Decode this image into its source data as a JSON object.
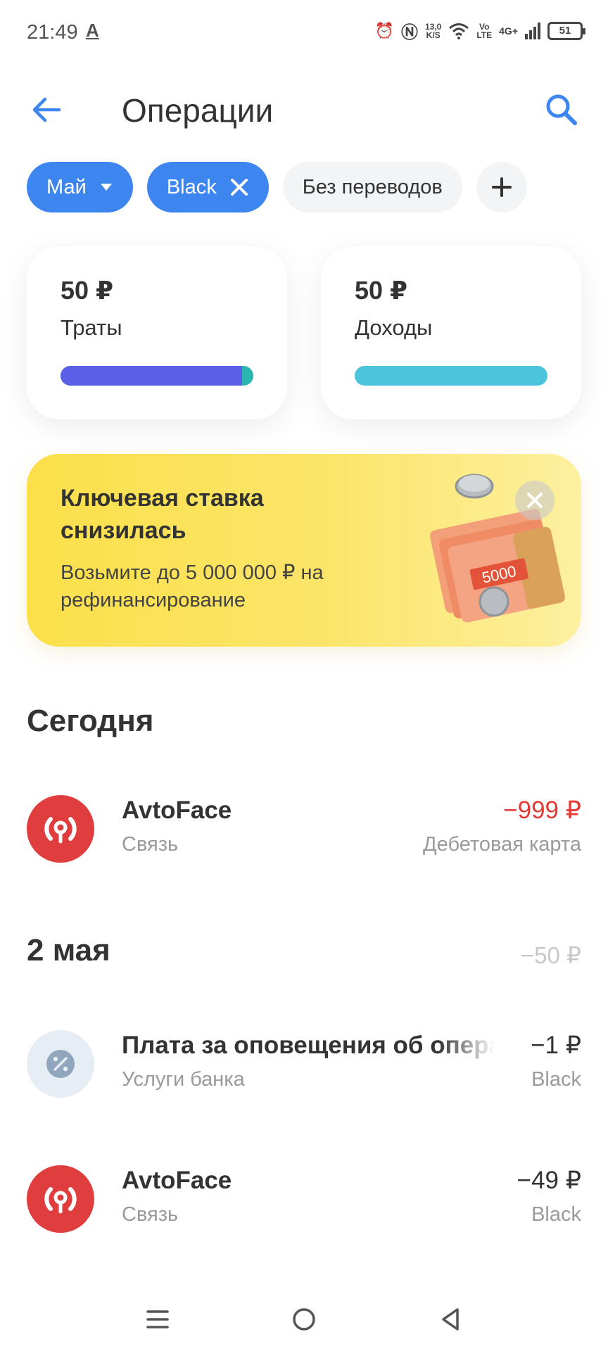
{
  "status_bar": {
    "time": "21:49",
    "a_icon": "A",
    "speed_value": "13,0",
    "speed_unit": "K/S",
    "volte_top": "Vo",
    "volte_bottom": "LTE",
    "network": "4G+",
    "battery": "51"
  },
  "header": {
    "title": "Операции"
  },
  "filters": {
    "month": "Май",
    "card": "Black",
    "no_transfers": "Без переводов"
  },
  "summary": {
    "expenses": {
      "amount": "50 ₽",
      "label": "Траты",
      "fill": 0.94,
      "color": "#5b5fe8",
      "accent": "#2bb5b0"
    },
    "income": {
      "amount": "50 ₽",
      "label": "Доходы",
      "fill": 1.0,
      "color": "#4cc4dc"
    }
  },
  "promo": {
    "title": "Ключевая ставка снизилась",
    "text": "Возьмите до 5 000 000 ₽ на рефинансирование",
    "banknote": "5000"
  },
  "sections": [
    {
      "title": "Сегодня",
      "total": "",
      "operations": [
        {
          "name": "AvtoFace",
          "category": "Связь",
          "amount": "−999 ₽",
          "account": "Дебетовая карта",
          "icon": "signal-icon",
          "amount_color": "#e53935"
        }
      ]
    },
    {
      "title": "2 мая",
      "total": "−50 ₽",
      "operations": [
        {
          "name": "Плата за оповещения об операциях",
          "category": "Услуги банка",
          "amount": "−1 ₽",
          "account": "Black",
          "icon": "percent-icon"
        },
        {
          "name": "AvtoFace",
          "category": "Связь",
          "amount": "−49 ₽",
          "account": "Black",
          "icon": "signal-icon"
        }
      ]
    }
  ],
  "colors": {
    "accent": "#3d86f0",
    "negative": "#e53935",
    "signal_icon_bg": "#e03e3e",
    "bank_icon_bg": "#e6edf5"
  }
}
